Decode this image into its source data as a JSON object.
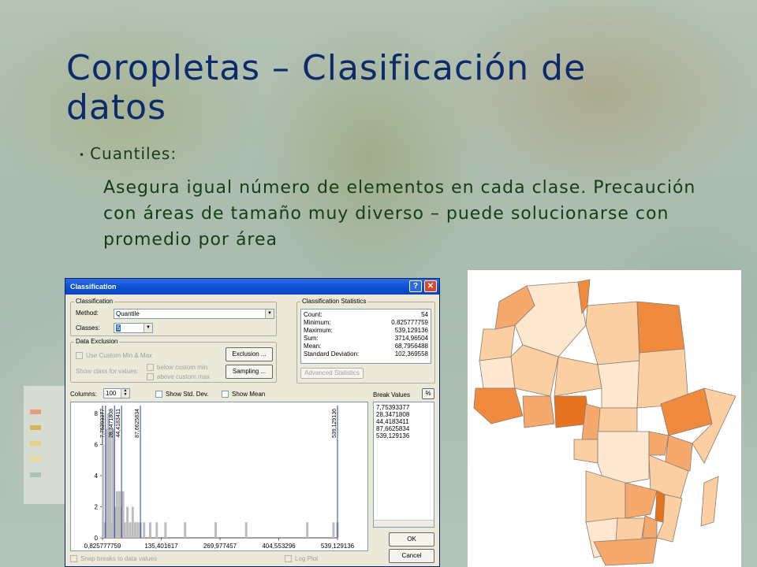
{
  "slide": {
    "title": "Coropletas – Clasificación de datos",
    "bullet": "Cuantiles:",
    "text": "Asegura igual número de elementos en cada clase. Precaución con áreas de tamaño muy diverso – puede solucionarse con promedio por área"
  },
  "dialog": {
    "title": "Classification",
    "help": "?",
    "close": "✕",
    "classification_group": "Classification",
    "method_label": "Method:",
    "method_value": "Quantile",
    "classes_label": "Classes:",
    "classes_value": "5",
    "data_exclusion_group": "Data Exclusion",
    "use_custom": "Use Custom Min & Max",
    "show_class": "Show class for values:",
    "below_custom": "below custom min",
    "above_custom": "above custom max",
    "exclusion_btn": "Exclusion ...",
    "sampling_btn": "Sampling ...",
    "stats_group": "Classification Statistics",
    "stats": [
      {
        "label": "Count:",
        "value": "54"
      },
      {
        "label": "Minimum:",
        "value": "0,825777759"
      },
      {
        "label": "Maximum:",
        "value": "539,129136"
      },
      {
        "label": "Sum:",
        "value": "3714,96504"
      },
      {
        "label": "Mean:",
        "value": "68,7956488"
      },
      {
        "label": "Standard Deviation:",
        "value": "102,369558"
      }
    ],
    "advanced_btn": "Advanced Statistics",
    "columns_label": "Columns:",
    "columns_value": "100",
    "show_std": "Show Std. Dev.",
    "show_mean": "Show Mean",
    "break_values_label": "Break Values",
    "percent_btn": "%",
    "break_values": [
      "7,75393377",
      "28,3471808",
      "44,4183411",
      "87,6625834",
      "539,129136"
    ],
    "ok_btn": "OK",
    "cancel_btn": "Cancel",
    "snap_breaks": "Snap breaks to data values",
    "log_plot": "Log Plot"
  },
  "chart_data": {
    "type": "bar",
    "title": "",
    "x_ticks": [
      "0,825777759",
      "135,401617",
      "269,977457",
      "404,553296",
      "539,129136"
    ],
    "y_ticks": [
      "0",
      "2",
      "4",
      "6",
      "8"
    ],
    "xlim": [
      0.825777759,
      539.129136
    ],
    "ylim": [
      0,
      8.5
    ],
    "x": [
      2,
      5,
      8,
      11,
      14,
      16,
      19,
      22,
      25,
      28,
      31,
      34,
      37,
      40,
      44,
      48,
      52,
      58,
      64,
      70,
      76,
      82,
      88,
      96,
      110,
      125,
      145,
      190,
      260,
      330,
      470,
      530,
      539
    ],
    "values": [
      6,
      1,
      1,
      7,
      8,
      3,
      7,
      1,
      7,
      2,
      2,
      3,
      2,
      3,
      2,
      3,
      1,
      2,
      1,
      2,
      1,
      1,
      1,
      1,
      1,
      1,
      1,
      1,
      1,
      1,
      1,
      1,
      1
    ],
    "break_lines": [
      7.75393377,
      28.3471808,
      44.4183411,
      87.6625834,
      539.129136
    ],
    "break_labels": [
      "7,75393377",
      "28,3471808",
      "44,4183411",
      "87,6625834",
      "539,129136"
    ],
    "colors": {
      "bars": "#bdbdbd",
      "breaks": "#2a3fa0"
    }
  },
  "map": {
    "colors": [
      "#fde7cf",
      "#fbcfa2",
      "#f6a96c",
      "#ef8a3e",
      "#e6731f"
    ]
  }
}
